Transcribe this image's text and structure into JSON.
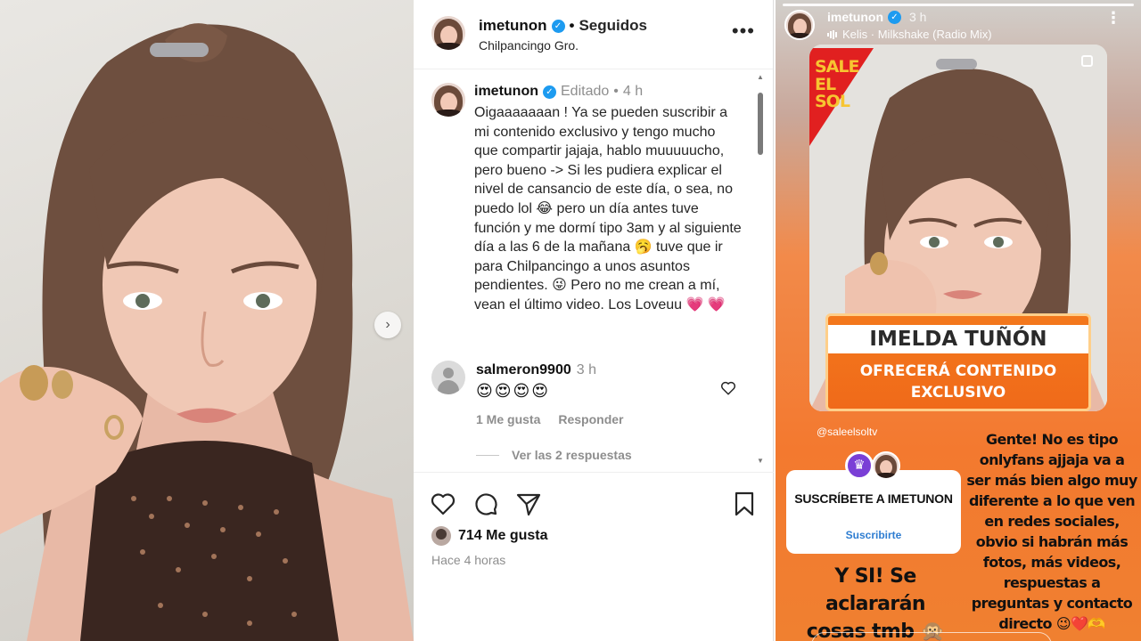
{
  "post": {
    "username": "imetunon",
    "follow_status": "Seguidos",
    "separator": "•",
    "location": "Chilpancingo Gro.",
    "more_glyph": "•••",
    "carousel_next_glyph": "›",
    "caption": {
      "username": "imetunon",
      "edited_label": "Editado",
      "separator": "•",
      "time": "4 h",
      "text": "Oigaaaaaaan ! Ya se pueden suscribir a mi contenido exclusivo y tengo mucho que compartir jajaja, hablo muuuuucho, pero bueno -> Si les pudiera explicar el nivel de cansancio de este día, o sea, no puedo lol 😂 pero un día antes tuve función y me dormí tipo 3am y al siguiente día a las 6 de la mañana 🥱 tuve que ir para Chilpancingo a unos asuntos pendientes. 😜 Pero no me crean a mí, vean el último video. Los Loveuu 💗 💗"
    },
    "comment": {
      "username": "salmeron9900",
      "time": "3 h",
      "text": "😍😍😍😍",
      "likes_label": "1 Me gusta",
      "reply_label": "Responder",
      "view_replies_label": "Ver las 2 respuestas"
    },
    "likes_count_label": "714 Me gusta",
    "time_ago": "Hace 4 horas",
    "icons": [
      "heart-icon",
      "comment-icon",
      "share-icon",
      "bookmark-icon"
    ]
  },
  "story": {
    "username": "imetunon",
    "time": "3 h",
    "music": "Kelis · Milkshake (Radio Mix)",
    "more_glyph": "⋮",
    "card": {
      "logo_line1": "SALE",
      "logo_line2": "EL SOL",
      "banner_name": "IMELDA TUÑÓN",
      "banner_line1": "OFRECERÁ CONTENIDO",
      "banner_line2": "EXCLUSIVO"
    },
    "mention": "@saleelsoltv",
    "subscribe_sticker": {
      "title": "SUSCRÍBETE A IMETUNON",
      "button": "Suscribirte"
    },
    "text_right": "Gente! No es tipo onlyfans ajjaja va a ser más bien algo muy diferente a lo que ven en redes sociales, obvio si habrán más fotos, más videos, respuestas a preguntas y contacto directo 😉❤️🫶",
    "text_left": "Y SI! Se aclararán cosas tmb 🙊"
  },
  "colors": {
    "verified": "#1d9bf0",
    "story_orange": "#f3792f",
    "banner_orange": "#f06a1a",
    "logo_red": "#e12020",
    "logo_yellow": "#f7c531",
    "crown_purple": "#7a3fd6",
    "link_blue": "#2e7dd1"
  }
}
